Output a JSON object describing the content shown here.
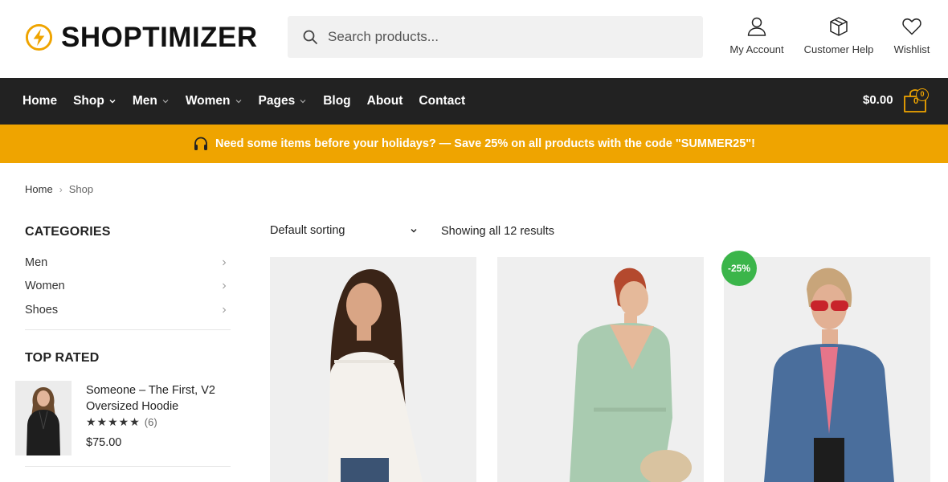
{
  "brand": {
    "name": "SHOPTIMIZER",
    "accent": "#efa400",
    "nav_bg": "#222222",
    "sale_color": "#3bb54a"
  },
  "search": {
    "placeholder": "Search products..."
  },
  "header_links": {
    "account": "My Account",
    "help": "Customer Help",
    "wishlist": "Wishlist"
  },
  "nav": {
    "items": [
      {
        "label": "Home",
        "dropdown": false
      },
      {
        "label": "Shop",
        "dropdown": true
      },
      {
        "label": "Men",
        "dropdown": true
      },
      {
        "label": "Women",
        "dropdown": true
      },
      {
        "label": "Pages",
        "dropdown": true
      },
      {
        "label": "Blog",
        "dropdown": false
      },
      {
        "label": "About",
        "dropdown": false
      },
      {
        "label": "Contact",
        "dropdown": false
      }
    ],
    "cart_total": "$0.00",
    "cart_count": "0",
    "cart_badge": "0"
  },
  "promo": {
    "text": "Need some items before your holidays? — Save 25% on all products with the code \"SUMMER25\"!",
    "icon": "headphones-icon"
  },
  "breadcrumb": {
    "home": "Home",
    "current": "Shop"
  },
  "sidebar": {
    "categories_title": "CATEGORIES",
    "categories": [
      "Men",
      "Women",
      "Shoes"
    ],
    "top_rated_title": "TOP RATED",
    "top_rated": {
      "title": "Someone – The First, V2 Oversized Hoodie",
      "stars": "★★★★★",
      "rating": 4.5,
      "count": "(6)",
      "price": "$75.00"
    }
  },
  "toolbar": {
    "sorting": "Default sorting",
    "results": "Showing all 12 results"
  },
  "products": [
    {
      "badge": ""
    },
    {
      "badge": ""
    },
    {
      "badge": "-25%"
    }
  ]
}
